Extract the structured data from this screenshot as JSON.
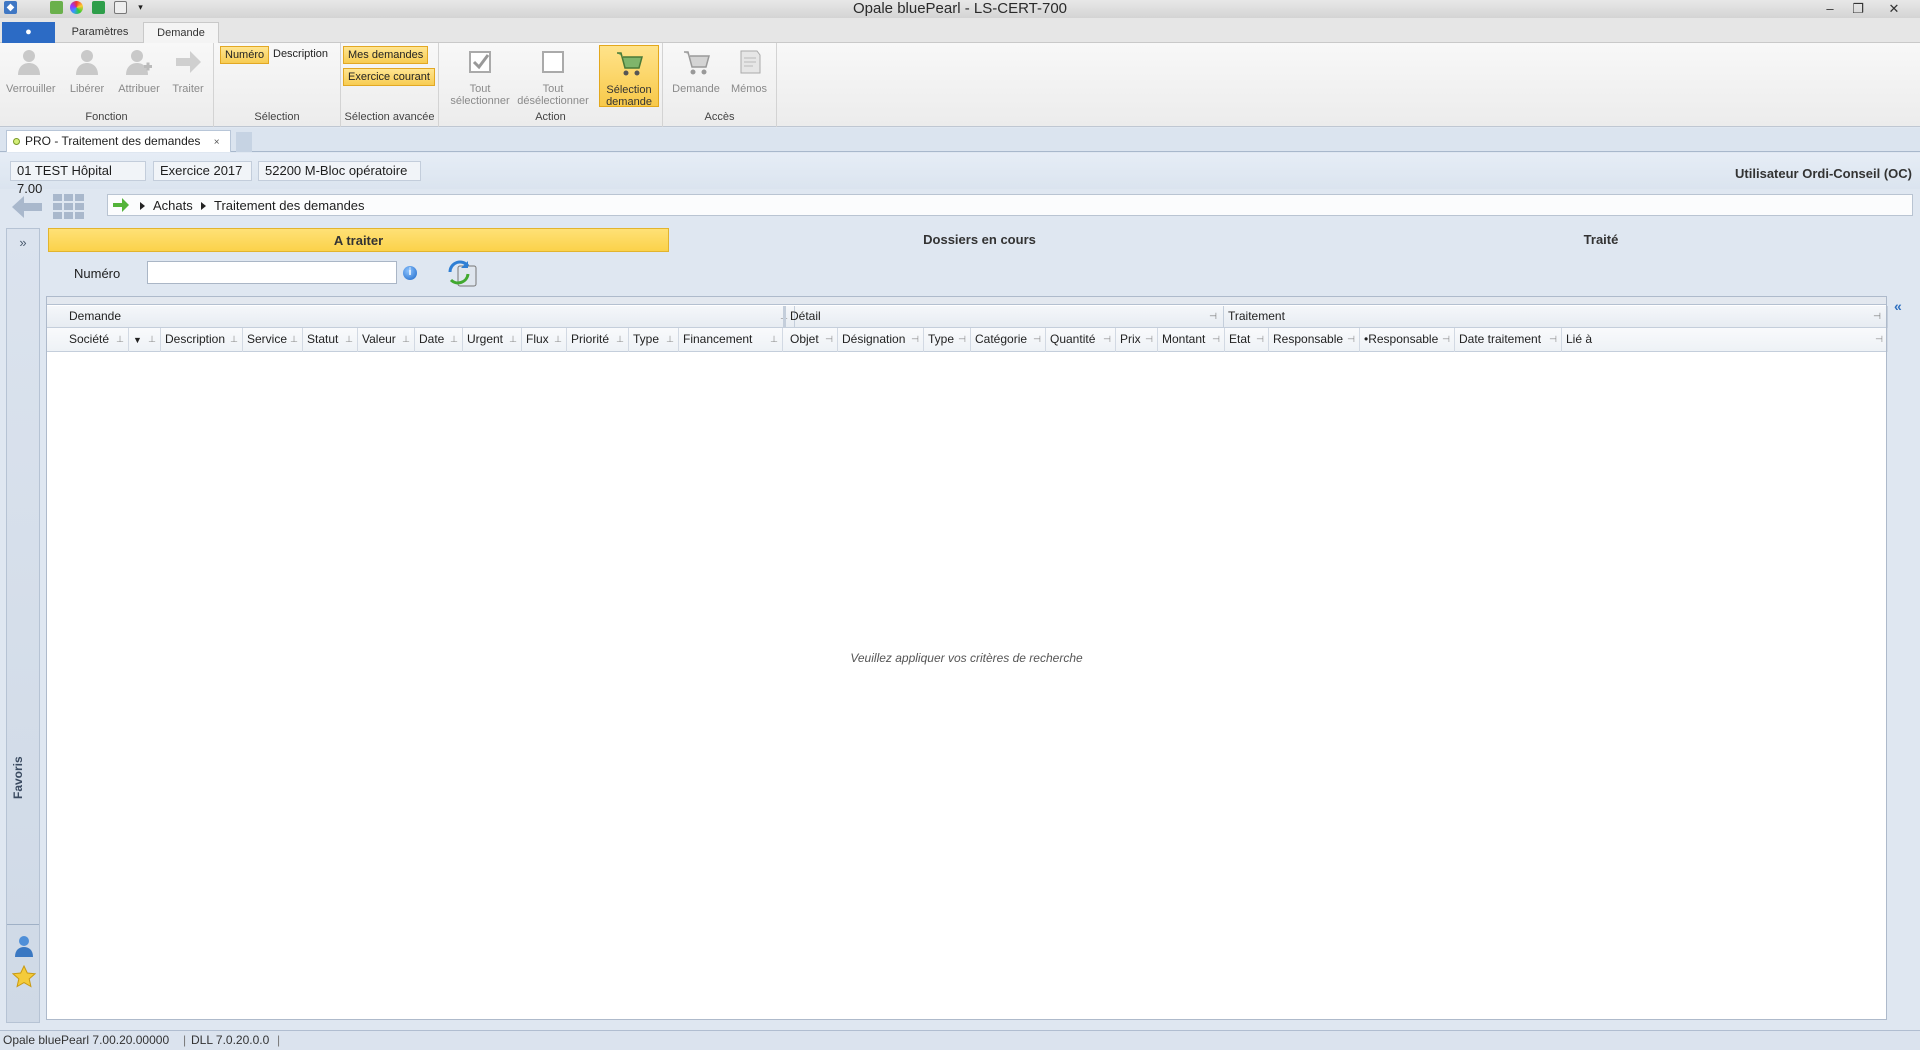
{
  "window": {
    "title": "Opale bluePearl   -   LS-CERT-700",
    "controls": {
      "minimize": "–",
      "restore": "❐",
      "close": "✕"
    }
  },
  "ribbon": {
    "file_tab": "●",
    "tabs": [
      "Paramètres",
      "Demande"
    ],
    "active_tab": "Demande",
    "groups": {
      "fonction": {
        "label": "Fonction",
        "buttons": [
          "Verrouiller",
          "Libérer",
          "Attribuer",
          "Traiter"
        ]
      },
      "selection": {
        "label": "Sélection",
        "buttons": [
          "Numéro",
          "Description"
        ]
      },
      "selection_avancee": {
        "label": "Sélection avancée",
        "buttons": [
          "Mes demandes",
          "Exercice courant"
        ]
      },
      "action": {
        "label": "Action",
        "buttons": [
          {
            "line1": "Tout",
            "line2": "sélectionner"
          },
          {
            "line1": "Tout",
            "line2": "désélectionner"
          },
          {
            "line1": "Sélection",
            "line2": "demande"
          }
        ]
      },
      "acces": {
        "label": "Accès",
        "buttons": [
          "Demande",
          "Mémos"
        ]
      }
    }
  },
  "document_tab": {
    "label": "PRO - Traitement des demandes",
    "close": "×"
  },
  "context": {
    "company": "01 TEST Hôpital 7.00",
    "exercise": "Exercice 2017",
    "service": "52200 M-Bloc opératoire",
    "user": "Utilisateur Ordi-Conseil (OC)"
  },
  "breadcrumb": [
    "Achats",
    "Traitement des demandes"
  ],
  "favoris": {
    "label": "Favoris",
    "expand": "»"
  },
  "status_tabs": [
    "A traiter",
    "Dossiers en cours",
    "Traité"
  ],
  "search": {
    "label": "Numéro",
    "value": "",
    "info": "i"
  },
  "grid": {
    "bands": [
      "Demande",
      "Détail",
      "Traitement"
    ],
    "columns": {
      "demande": [
        "Société",
        "",
        "Description",
        "Service",
        "Statut",
        "Valeur",
        "Date",
        "Urgent",
        "Flux",
        "Priorité",
        "Type",
        "Financement"
      ],
      "detail": [
        "Objet",
        "Désignation",
        "Type",
        "Catégorie",
        "Quantité",
        "Prix",
        "Montant"
      ],
      "traitement": [
        "Etat",
        "Responsable",
        "•Responsable",
        "Date traitement",
        "Lié à"
      ]
    },
    "empty_message": "Veuillez appliquer vos critères de recherche",
    "collapse": "«"
  },
  "statusbar": {
    "version": "Opale bluePearl 7.00.20.00000",
    "dll": "DLL 7.0.20.0.0"
  },
  "colors": {
    "accent_yellow": "#fbd24a",
    "file_tab_blue": "#2c6bc5",
    "background": "#dfe7f1"
  }
}
